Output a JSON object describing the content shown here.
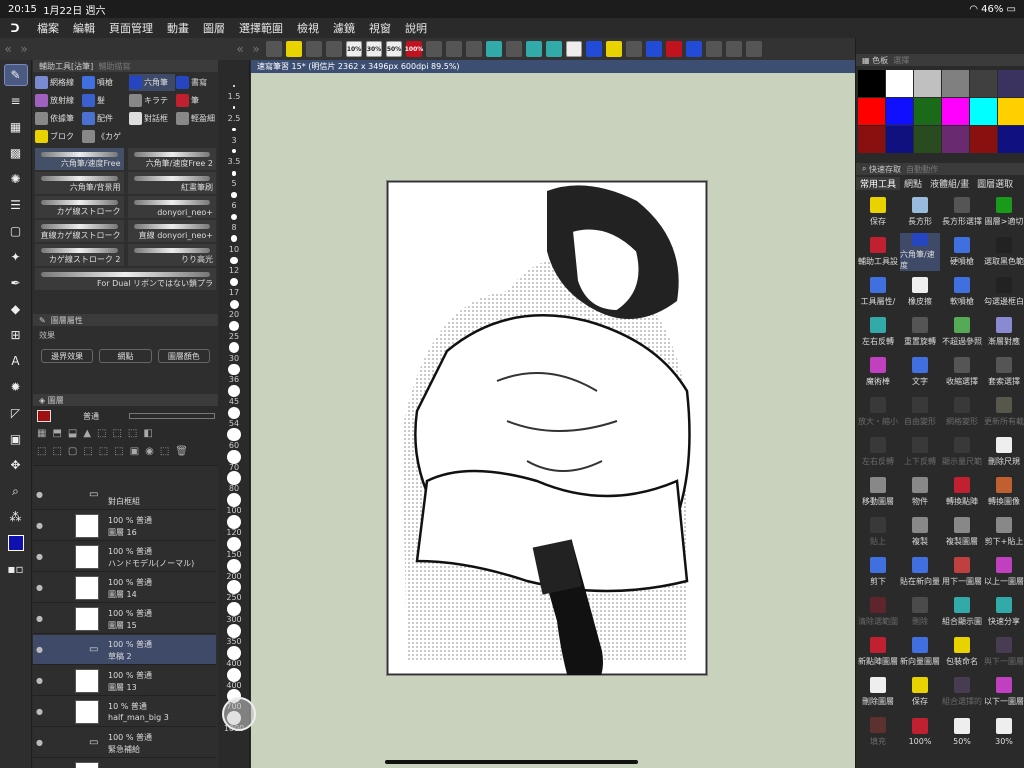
{
  "status": {
    "time": "20:15",
    "date": "1月22日 週六",
    "battery": "46%"
  },
  "menu": [
    "檔案",
    "編輯",
    "頁面管理",
    "動畫",
    "圖層",
    "選擇範圍",
    "檢視",
    "濾鏡",
    "視窗",
    "說明"
  ],
  "cmdbar": {
    "buttons": [
      {
        "label": "",
        "style": "gray"
      },
      {
        "label": "",
        "style": "yellow"
      },
      {
        "label": "",
        "style": "gray"
      },
      {
        "label": "",
        "style": "gray"
      },
      {
        "label": "10%",
        "style": "white"
      },
      {
        "label": "30%",
        "style": "white"
      },
      {
        "label": "50%",
        "style": "white"
      },
      {
        "label": "100%",
        "style": "red"
      },
      {
        "label": "",
        "style": "gray"
      },
      {
        "label": "",
        "style": "gray"
      },
      {
        "label": "",
        "style": "gray"
      },
      {
        "label": "",
        "style": "teal"
      },
      {
        "label": "",
        "style": "gray"
      },
      {
        "label": "",
        "style": "teal"
      },
      {
        "label": "",
        "style": "teal"
      },
      {
        "label": "",
        "style": "white"
      },
      {
        "label": "",
        "style": "blue"
      },
      {
        "label": "",
        "style": "yellow"
      },
      {
        "label": "",
        "style": "gray"
      },
      {
        "label": "",
        "style": "blue"
      },
      {
        "label": "",
        "style": "red"
      },
      {
        "label": "",
        "style": "blue"
      },
      {
        "label": "",
        "style": "gray"
      },
      {
        "label": "",
        "style": "gray"
      },
      {
        "label": "",
        "style": "gray"
      }
    ]
  },
  "subtool": {
    "title": "輔助工具[沾筆]",
    "tab2": "輔助描寫",
    "items": [
      {
        "label": "網格線",
        "color": "#7a8ad0"
      },
      {
        "label": "噴槍",
        "color": "#4070e0"
      },
      {
        "label": "六角筆",
        "color": "#2546c0",
        "selected": true
      },
      {
        "label": "書寫",
        "color": "#2546c0"
      },
      {
        "label": "放射線",
        "color": "#a060c0"
      },
      {
        "label": "髮",
        "color": "#3a60d0"
      },
      {
        "label": "キラテ",
        "color": "#888"
      },
      {
        "label": "筆",
        "color": "#c02030"
      },
      {
        "label": "依據筆",
        "color": "#888"
      },
      {
        "label": "配件",
        "color": "#4a70d0"
      },
      {
        "label": "對話框",
        "color": "#ddd"
      },
      {
        "label": "輕盈細",
        "color": "#888"
      },
      {
        "label": "ブロク",
        "color": "#e8d300"
      },
      {
        "label": "《カゲ",
        "color": "#888"
      }
    ],
    "brushes": [
      [
        "六角筆/速度Free",
        "六角筆/速度Free 2"
      ],
      [
        "六角筆/背景用",
        "紅畫筆刷"
      ],
      [
        "カゲ線ストローク",
        "donyori_neo+"
      ],
      [
        "直線カゲ線ストローク",
        "直線 donyori_neo+"
      ],
      [
        "カゲ線ストローク 2",
        "りり高光"
      ]
    ],
    "brush_last": "For Dual リボンではない鎖プラ"
  },
  "props": {
    "tab1": "",
    "tab2": "圖層屬性",
    "section": "效果",
    "effects": [
      "邊界效果",
      "網點",
      "圖層顏色"
    ]
  },
  "layers": {
    "title": "圖層",
    "blend_mode": "普通",
    "items": [
      {
        "pct": "",
        "name": "對白框組",
        "folder": true
      },
      {
        "pct": "100 %  普通",
        "name": "圖層 16"
      },
      {
        "pct": "100 %  普通",
        "name": "ハンドモデル(ノーマル)"
      },
      {
        "pct": "100 %  普通",
        "name": "圖層 14"
      },
      {
        "pct": "100 %  普通",
        "name": "圖層 15"
      },
      {
        "pct": "100 %  普通",
        "name": "草稿 2",
        "folder": true,
        "selected": true
      },
      {
        "pct": "100 %  普通",
        "name": "圖層 13"
      },
      {
        "pct": "10 %  普通",
        "name": "half_man_big 3"
      },
      {
        "pct": "100 %  普通",
        "name": "緊急補給",
        "folder": true
      },
      {
        "pct": "",
        "name": "紙張"
      }
    ]
  },
  "sizes": [
    "1.5",
    "2.5",
    "3",
    "3.5",
    "5",
    "6",
    "8",
    "10",
    "12",
    "17",
    "20",
    "25",
    "30",
    "36",
    "45",
    "54",
    "60",
    "70",
    "80",
    "100",
    "120",
    "150",
    "200",
    "250",
    "300",
    "350",
    "400",
    "400",
    "700",
    "1000"
  ],
  "canvas": {
    "tab": "速寫筆習 15* (明信片 2362 x 3496px 600dpi 89.5%)"
  },
  "palette": {
    "title": "色板",
    "tab2": "選擇",
    "colors": [
      "#000000",
      "#ffffff",
      "#c0c0c0",
      "#808080",
      "#404040",
      "#3a3360",
      "#ff0000",
      "#1010ff",
      "#1a6a1a",
      "#ff00ff",
      "#00ffff",
      "#ffd000",
      "#8a1010",
      "#101080",
      "#2a4a20",
      "#6a2a70",
      "#8a1010",
      "#101080"
    ]
  },
  "quick": {
    "title": "快速存取",
    "tab2": "自動動作",
    "tabs": [
      "常用工具",
      "網點",
      "液體組/畫",
      "圖層選取"
    ],
    "items": [
      {
        "label": "保存",
        "color": "#e8d300"
      },
      {
        "label": "長方形",
        "color": "#9bd"
      },
      {
        "label": "長方形選擇",
        "color": "#555"
      },
      {
        "label": "圖層>適切",
        "color": "#1a9a1a"
      },
      {
        "label": "輔助工具設",
        "color": "#c02030"
      },
      {
        "label": "六角筆/速度",
        "color": "#2546c0",
        "selected": true
      },
      {
        "label": "硬噴槍",
        "color": "#4070e0"
      },
      {
        "label": "選取黑色範",
        "color": "#222"
      },
      {
        "label": "工具屬性/",
        "color": "#4070e0"
      },
      {
        "label": "橡皮擦",
        "color": "#eee"
      },
      {
        "label": "軟噴槍",
        "color": "#4070e0"
      },
      {
        "label": "勾選邊框白",
        "color": "#222"
      },
      {
        "label": "左右反轉",
        "color": "#3aa"
      },
      {
        "label": "重置旋轉",
        "color": "#555"
      },
      {
        "label": "不超過參照",
        "color": "#5a5"
      },
      {
        "label": "漸層對應",
        "color": "#8a8ad0"
      },
      {
        "label": "魔術棒",
        "color": "#c040c0"
      },
      {
        "label": "文字",
        "color": "#4070e0"
      },
      {
        "label": "收縮選擇",
        "color": "#555"
      },
      {
        "label": "套索選擇",
        "color": "#555"
      },
      {
        "label": "放大・縮小",
        "color": "#555",
        "dim": true
      },
      {
        "label": "自由變形",
        "color": "#555",
        "dim": true
      },
      {
        "label": "網格變形",
        "color": "#555",
        "dim": true
      },
      {
        "label": "更新所有載",
        "color": "#aa8",
        "dim": true
      },
      {
        "label": "左右反轉",
        "color": "#555",
        "dim": true
      },
      {
        "label": "上下反轉",
        "color": "#555",
        "dim": true
      },
      {
        "label": "顯示量尺範",
        "color": "#555",
        "dim": true
      },
      {
        "label": "刪除尺規",
        "color": "#eee"
      },
      {
        "label": "移動圖層",
        "color": "#888"
      },
      {
        "label": "物件",
        "color": "#888"
      },
      {
        "label": "轉換點陣",
        "color": "#c02030"
      },
      {
        "label": "轉換圖像",
        "color": "#c06030"
      },
      {
        "label": "貼上",
        "color": "#555",
        "dim": true
      },
      {
        "label": "複製",
        "color": "#888"
      },
      {
        "label": "複製圖層",
        "color": "#888"
      },
      {
        "label": "剪下+貼上",
        "color": "#888"
      },
      {
        "label": "剪下",
        "color": "#4070e0"
      },
      {
        "label": "貼在新向量",
        "color": "#4070e0"
      },
      {
        "label": "用下一圖層",
        "color": "#c04040"
      },
      {
        "label": "以上一圖層",
        "color": "#c040c0"
      },
      {
        "label": "清除選範圍",
        "color": "#c02030",
        "dim": true
      },
      {
        "label": "刪除",
        "color": "#888",
        "dim": true
      },
      {
        "label": "組合顯示圖",
        "color": "#3aa"
      },
      {
        "label": "快速分享",
        "color": "#3aa"
      },
      {
        "label": "新點陣圖層",
        "color": "#c02030"
      },
      {
        "label": "新向量圖層",
        "color": "#4070e0"
      },
      {
        "label": "包裝命名",
        "color": "#e8d300"
      },
      {
        "label": "與下一圖層",
        "color": "#8060a0",
        "dim": true
      },
      {
        "label": "刪除圖層",
        "color": "#eee"
      },
      {
        "label": "保存",
        "color": "#e8d300"
      },
      {
        "label": "組合選擇的",
        "color": "#8060a0",
        "dim": true
      },
      {
        "label": "以下一圖層",
        "color": "#c040c0"
      },
      {
        "label": "填充",
        "color": "#c04040",
        "dim": true
      },
      {
        "label": "100%",
        "color": "#c02030"
      },
      {
        "label": "50%",
        "color": "#eee"
      },
      {
        "label": "30%",
        "color": "#eee"
      }
    ]
  }
}
